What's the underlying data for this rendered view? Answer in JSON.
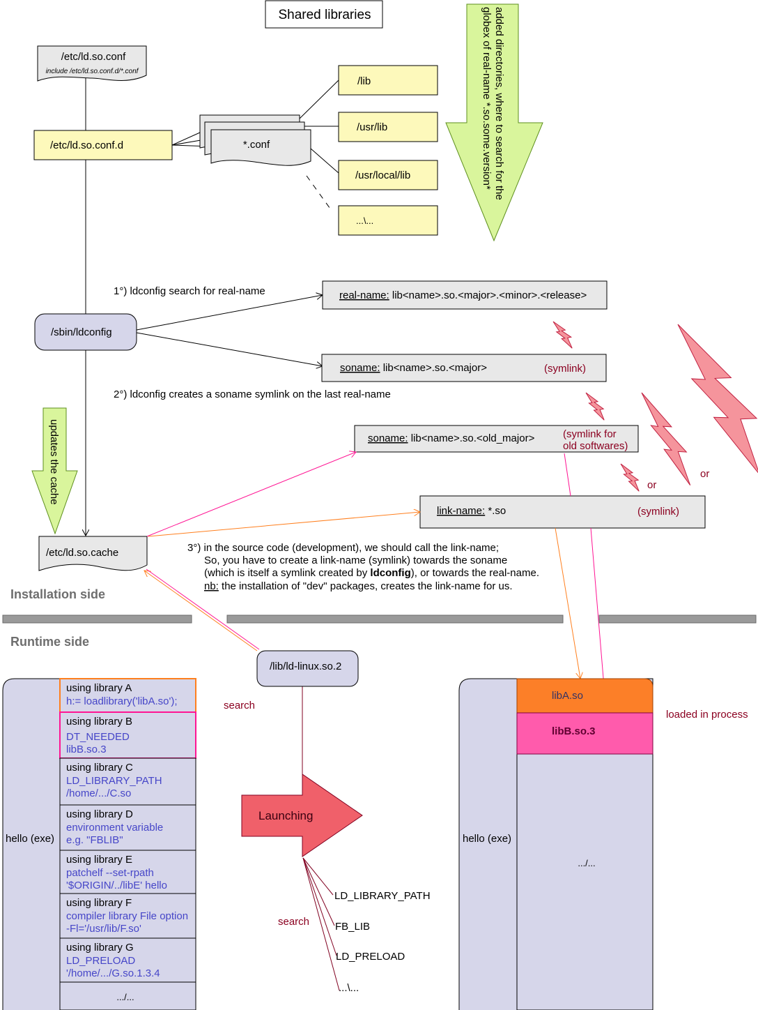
{
  "title": "Shared libraries",
  "colors": {
    "yellow": "#fdf9bb",
    "grey_box": "#e8e8e8",
    "lavender": "#d6d6ea",
    "green_arrow": "#d9f59c",
    "launch": "#f0606a",
    "libA": "#fc7f28",
    "libB": "#ff5bac",
    "dark_red": "#8b0020",
    "blue_text": "#4646c8",
    "bolt": "#f5949c"
  },
  "config": {
    "ld_so_conf": "/etc/ld.so.conf",
    "ld_so_conf_include": "include /etc/ld.so.conf.d/*.conf",
    "ld_so_conf_d": "/etc/ld.so.conf.d",
    "conf_files": "*.conf",
    "dirs": [
      "/lib",
      "/usr/lib",
      "/usr/local/lib",
      "...\\..."
    ],
    "big_arrow_lines": [
      "added directories, where to search for the",
      "globex of real-name *.so.some.version*"
    ]
  },
  "ldconfig": {
    "label": "/sbin/ldconfig",
    "step1": "1°)  ldconfig search for real-name",
    "step2": "2°)  ldconfig creates a soname symlink on the last real-name",
    "updates_cache": "updates the cache",
    "cache": "/etc/ld.so.cache"
  },
  "names": {
    "real_name_key": "real-name:",
    "real_name_val": " lib<name>.so.<major>.<minor>.<release>",
    "soname_key": "soname:",
    "soname_val": " lib<name>.so.<major>",
    "soname_note": "(symlink)",
    "old_soname_key": "soname:",
    "old_soname_val": " lib<name>.so.<old_major>",
    "old_soname_note": [
      "(symlink for",
      "old softwares)"
    ],
    "link_name_key": "link-name:",
    "link_name_val": " *.so",
    "link_name_note": "(symlink)",
    "or_labels": [
      "or",
      "or"
    ]
  },
  "step3": {
    "line1": "3°) in the source code (development), we should call the link-name;",
    "line2": "So,  you have to create a link-name (symlink) towards the soname",
    "line3_a": "(which is itself a symlink created by ",
    "line3_bold": "ldconfig",
    "line3_b": "), or towards the real-name.",
    "line4_key": "nb:",
    "line4_val": " the installation of \"dev\" packages, creates the link-name for us."
  },
  "sides": {
    "installation": "Installation side",
    "runtime": "Runtime side"
  },
  "runtime": {
    "ld_linux": "/lib/ld-linux.so.2",
    "search_top": "search",
    "launching": "Launching",
    "search_bottom": "search",
    "search_paths": [
      "LD_LIBRARY_PATH",
      "FB_LIB",
      "LD_PRELOAD",
      "...\\..."
    ],
    "exe_label": "hello (exe)",
    "libraries": [
      {
        "title": "using library A",
        "lines": [
          "h:= loadlibrary('libA.so');"
        ]
      },
      {
        "title": "using library B",
        "lines": [
          "DT_NEEDED",
          "libB.so.3"
        ]
      },
      {
        "title": "using library C",
        "lines": [
          "LD_LIBRARY_PATH",
          "/home/.../C.so"
        ]
      },
      {
        "title": "using library D",
        "lines": [
          "environment variable",
          "e.g. \"FBLIB\""
        ]
      },
      {
        "title": "using library E",
        "lines": [
          "patchelf --set-rpath",
          "'$ORIGIN/../libE' hello"
        ]
      },
      {
        "title": "using library F",
        "lines": [
          "compiler library File option",
          "-Fl='/usr/lib/F.so'"
        ]
      },
      {
        "title": "using library G",
        "lines": [
          "LD_PRELOAD",
          "'/home/.../G.so.1.3.4"
        ]
      }
    ],
    "more": ".../...",
    "process_exe_label": "hello (exe)",
    "loaded": [
      "libA.so",
      "libB.so.3"
    ],
    "process_more": ".../...",
    "loaded_in_process": "loaded in process"
  }
}
